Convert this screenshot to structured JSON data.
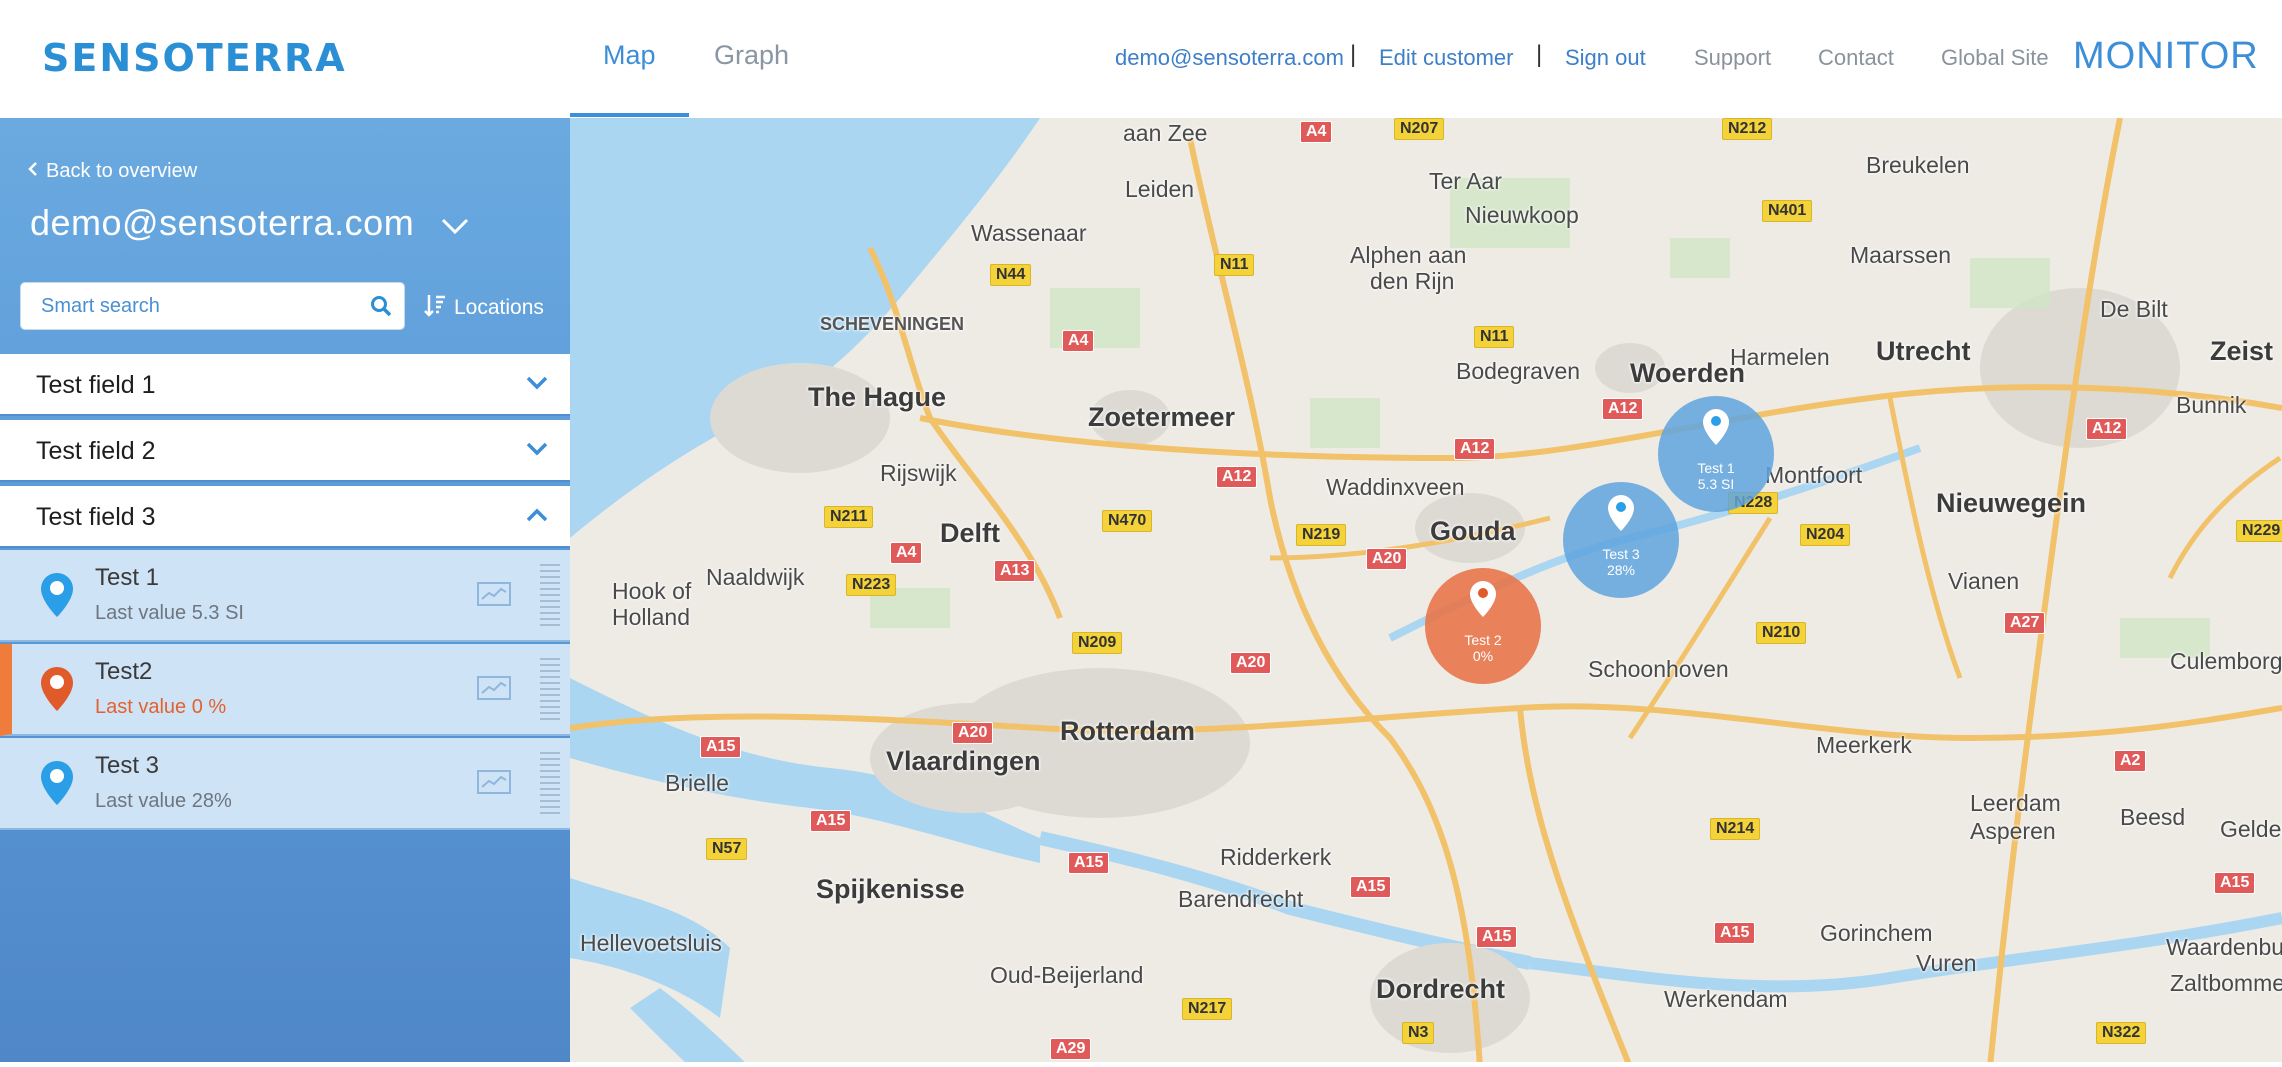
{
  "header": {
    "logo": "SENSOTERRA",
    "tabs": [
      {
        "label": "Map",
        "active": true
      },
      {
        "label": "Graph",
        "active": false
      }
    ],
    "user_email": "demo@sensoterra.com",
    "separator": "|",
    "edit_customer": "Edit customer",
    "sign_out": "Sign out",
    "support": "Support",
    "contact": "Contact",
    "global_site": "Global Site",
    "product": "MONITOR"
  },
  "sidebar": {
    "back_label": "Back to overview",
    "account": "demo@sensoterra.com",
    "search_placeholder": "Smart search",
    "locations_label": "Locations",
    "fields": [
      {
        "label": "Test field 1",
        "expanded": false
      },
      {
        "label": "Test field 2",
        "expanded": false
      },
      {
        "label": "Test field 3",
        "expanded": true
      }
    ],
    "sensors": [
      {
        "name": "Test 1",
        "value": "Last value 5.3 SI",
        "status": "normal"
      },
      {
        "name": "Test2",
        "value": "Last value 0 %",
        "status": "alert"
      },
      {
        "name": "Test 3",
        "value": "Last value 28%",
        "status": "normal"
      }
    ]
  },
  "map": {
    "cities": [
      "Leiden",
      "Wassenaar",
      "Ter Aar",
      "Nieuwkoop",
      "Alphen aan",
      "den Rijn",
      "Breukelen",
      "Maarssen",
      "De Bilt",
      "Utrecht",
      "Zeist",
      "Bunnik",
      "Nieuwegein",
      "Montfoort",
      "Woerden",
      "Harmelen",
      "Bodegraven",
      "SCHEVENINGEN",
      "The Hague",
      "Zoetermeer",
      "Rijswijk",
      "Waddinxveen",
      "Gouda",
      "Delft",
      "Naaldwijk",
      "Hook of",
      "Holland",
      "Vianen",
      "Culemborg",
      "Schoonhoven",
      "Rotterdam",
      "Vlaardingen",
      "Meerkerk",
      "Leerdam",
      "Asperen",
      "Beesd",
      "Gelder",
      "Brielle",
      "Spijkenisse",
      "Ridderkerk",
      "Barendrecht",
      "Hellevoetsluis",
      "Gorinchem",
      "Vuren",
      "Waardenbu",
      "Zaltbomme",
      "Oud-Beijerland",
      "Dordrecht",
      "Werkendam",
      "aan Zee"
    ],
    "roads": [
      "A4",
      "N207",
      "N212",
      "N401",
      "N44",
      "N11",
      "A4",
      "N11",
      "A12",
      "A12",
      "A12",
      "N228",
      "N204",
      "N229",
      "A12",
      "N211",
      "N470",
      "N219",
      "A20",
      "A4",
      "A13",
      "N223",
      "N209",
      "A20",
      "N210",
      "A27",
      "A20",
      "A15",
      "A2",
      "N214",
      "A15",
      "N57",
      "A15",
      "A15",
      "A15",
      "A15",
      "A15",
      "N217",
      "N3",
      "N322",
      "A29"
    ],
    "markers": [
      {
        "name": "Test 1",
        "value": "5.3 SI",
        "color": "#5fa5de"
      },
      {
        "name": "Test 3",
        "value": "28%",
        "color": "#5fa5de"
      },
      {
        "name": "Test 2",
        "value": "0%",
        "color": "#e8764a"
      }
    ]
  },
  "colors": {
    "brand": "#2a8fd4",
    "sidebar": "#5d9bd8",
    "alert": "#f07c3c"
  }
}
